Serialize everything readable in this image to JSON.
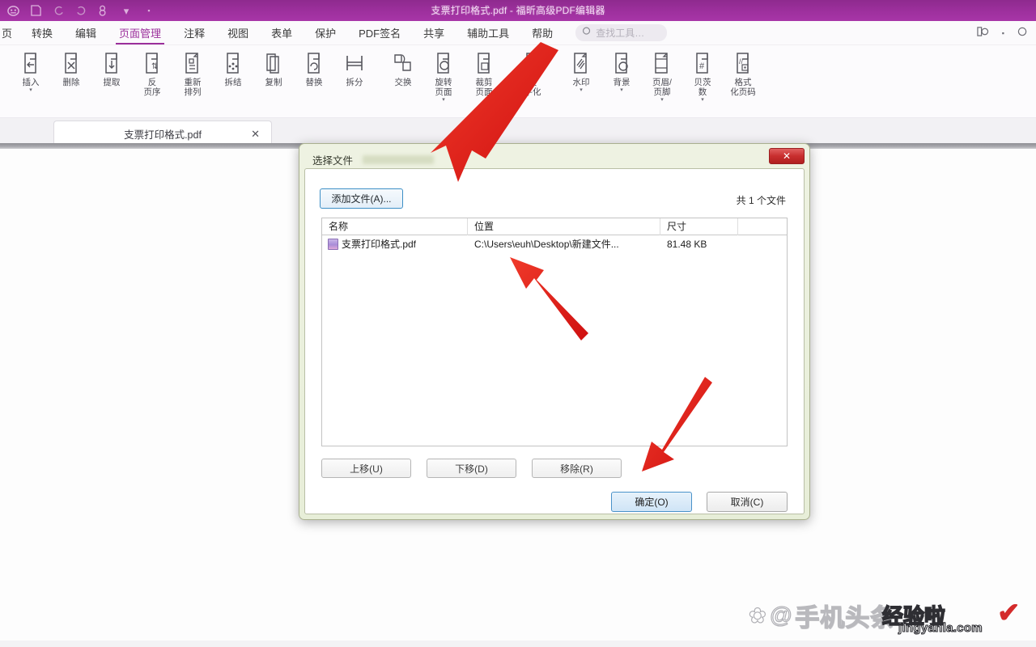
{
  "titlebar": {
    "document_title": "支票打印格式.pdf - 福昕高级PDF编辑器",
    "quick_access_icons": [
      "logo-icon",
      "save-icon",
      "undo-icon",
      "redo-icon",
      "print-icon",
      "customize-caret-icon",
      "more-icon"
    ]
  },
  "menubar": {
    "items": [
      {
        "label": "页",
        "active": false
      },
      {
        "label": "转换",
        "active": false
      },
      {
        "label": "编辑",
        "active": false
      },
      {
        "label": "页面管理",
        "active": true
      },
      {
        "label": "注释",
        "active": false
      },
      {
        "label": "视图",
        "active": false
      },
      {
        "label": "表单",
        "active": false
      },
      {
        "label": "保护",
        "active": false
      },
      {
        "label": "PDF签名",
        "active": false
      },
      {
        "label": "共享",
        "active": false
      },
      {
        "label": "辅助工具",
        "active": false
      },
      {
        "label": "帮助",
        "active": false
      }
    ],
    "search_placeholder": "查找工具…",
    "right_icons": [
      "account-icon",
      "caret-icon",
      "search-icon"
    ]
  },
  "ribbon": {
    "buttons": [
      {
        "icon": "page-insert-icon",
        "label": "插入",
        "caret": true
      },
      {
        "icon": "page-delete-icon",
        "label": "删除",
        "caret": false
      },
      {
        "icon": "page-extract-icon",
        "label": "提取",
        "caret": false
      },
      {
        "icon": "page-reverse-icon",
        "label": "反\n页序",
        "caret": false
      },
      {
        "icon": "page-rearrange-icon",
        "label": "重新\n排列",
        "caret": false
      },
      {
        "icon": "page-combine-icon",
        "label": "拆结",
        "caret": false
      },
      {
        "icon": "page-copy-icon",
        "label": "复制",
        "caret": false
      },
      {
        "icon": "page-replace-icon",
        "label": "替换",
        "caret": false
      },
      {
        "icon": "page-split-icon",
        "label": "拆分",
        "caret": false
      },
      {
        "icon": "page-swap-icon",
        "label": "交换",
        "caret": false
      },
      {
        "icon": "page-rotate-icon",
        "label": "旋转\n页面",
        "caret": true
      },
      {
        "icon": "page-crop-icon",
        "label": "裁剪\n页面",
        "caret": false
      },
      {
        "icon": "page-flatten-icon",
        "label": "展\n平化",
        "caret": false
      },
      {
        "icon": "watermark-icon",
        "label": "水印",
        "caret": true
      },
      {
        "icon": "background-icon",
        "label": "背景",
        "caret": true
      },
      {
        "icon": "header-footer-icon",
        "label": "页眉/\n页脚",
        "caret": true
      },
      {
        "icon": "bates-number-icon",
        "label": "贝茨\n数",
        "caret": true
      },
      {
        "icon": "format-page-number-icon",
        "label": "格式\n化页码",
        "caret": false
      }
    ]
  },
  "tabstrip": {
    "tab_name": "支票打印格式.pdf",
    "close_label": "✕"
  },
  "dialog": {
    "title": "选择文件",
    "close_label": "✕",
    "add_file_button": "添加文件(A)...",
    "file_count": "共 1 个文件",
    "columns": [
      "名称",
      "位置",
      "尺寸"
    ],
    "rows": [
      {
        "name": "支票打印格式.pdf",
        "location": "C:\\Users\\euh\\Desktop\\新建文件...",
        "size": "81.48 KB"
      }
    ],
    "move_buttons": [
      "上移(U)",
      "下移(D)",
      "移除(R)"
    ],
    "ok_button": "确定(O)",
    "cancel_button": "取消(C)"
  },
  "annotations": {
    "arrow_color": "#e02020",
    "arrows": [
      {
        "name": "arrow-to-add-file-button"
      },
      {
        "name": "arrow-to-file-location"
      },
      {
        "name": "arrow-to-ok-button"
      }
    ]
  },
  "watermark": {
    "text_main": "手机头条",
    "text_brand": "经验啦",
    "text_url": "jingyanla.com"
  }
}
